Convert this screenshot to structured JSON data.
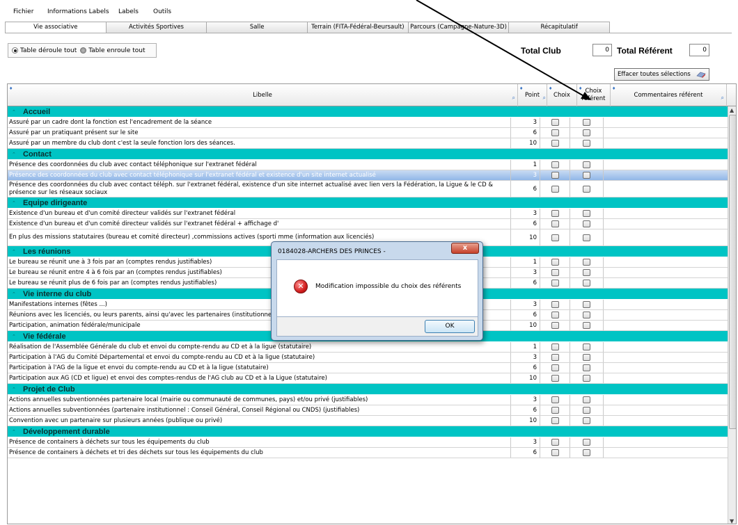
{
  "menu": [
    "Fichier",
    "Informations Labels",
    "Labels",
    "Outils"
  ],
  "tabs": [
    {
      "label": "Vie associative",
      "active": true
    },
    {
      "label": "Activités Sportives"
    },
    {
      "label": "Salle"
    },
    {
      "label": "Terrain (FITA-Fédéral-Beursault)"
    },
    {
      "label": "Parcours (Campagne-Nature-3D)"
    },
    {
      "label": "Récapitulatif"
    }
  ],
  "view": {
    "radio_expand": "Table déroule tout",
    "radio_collapse": "Table enroule tout",
    "selected": "expand"
  },
  "totals": {
    "club_label": "Total Club",
    "club_value": "0",
    "ref_label": "Total Référent",
    "ref_value": "0"
  },
  "clear_button": "Effacer toutes sélections",
  "columns": {
    "libelle": "Libelle",
    "point": "Point",
    "choix": "Choix",
    "choix_ref": "Choix référent",
    "comments": "Commentaires référent"
  },
  "sections": [
    {
      "title": "Accueil",
      "rows": [
        {
          "text": "Assuré par un cadre dont la fonction est l'encadrement de la séance",
          "pt": "3"
        },
        {
          "text": "Assuré par un pratiquant présent sur le site",
          "pt": "6"
        },
        {
          "text": "Assuré par un membre du club dont c'est la seule fonction lors des séances.",
          "pt": "10"
        }
      ]
    },
    {
      "title": "Contact",
      "rows": [
        {
          "text": "Présence des coordonnées du club avec contact téléphonique sur l'extranet fédéral",
          "pt": "1"
        },
        {
          "text": "Présence des coordonnées du club avec contact téléphonique sur l'extranet fédéral et existence d'un site internet actualisé",
          "pt": "3",
          "selected": true
        },
        {
          "text": "Présence des coordonnées du club avec contact téléph. sur l'extranet fédéral, existence d'un site internet actualisé avec lien vers la Fédération, la Ligue & le CD & présence sur les réseaux sociaux",
          "pt": "6",
          "tall": true
        }
      ]
    },
    {
      "title": "Equipe dirigeante",
      "rows": [
        {
          "text": "Existence d'un bureau et d'un comité directeur validés sur l'extranet fédéral",
          "pt": "3"
        },
        {
          "text": "Existence d'un bureau et d'un comité directeur validés sur l'extranet fédéral + affichage d'",
          "pt": "6"
        },
        {
          "text": "En plus des missions statutaires (bureau et comité directeur) ,commissions actives (sporti                                                                                                              mme (information aux licenciés)",
          "pt": "10",
          "tall": true
        }
      ]
    },
    {
      "title": "Les réunions",
      "rows": [
        {
          "text": "Le bureau se réunit une à 3 fois par an (comptes rendus justifiables)",
          "pt": "1"
        },
        {
          "text": "Le bureau se réunit entre 4 à 6 fois par an (comptes rendus justifiables)",
          "pt": "3"
        },
        {
          "text": "Le bureau se réunit plus de 6 fois par an (comptes rendus justifiables)",
          "pt": "6"
        }
      ]
    },
    {
      "title": "Vie interne du club",
      "rows": [
        {
          "text": "Manifestations internes (fêtes ...)",
          "pt": "3"
        },
        {
          "text": "Réunions avec les licenciés, ou leurs parents, ainsi qu'avec les partenaires (institutionnels ou privés)  (pouvoir justifier de lettres, invitations, convocations ...)",
          "pt": "6"
        },
        {
          "text": "Participation, animation fédérale/municipale",
          "pt": "10"
        }
      ]
    },
    {
      "title": "Vie fédérale",
      "rows": [
        {
          "text": "Réalisation de l'Assemblée Générale du club et envoi du compte-rendu au CD et à la ligue (statutaire)",
          "pt": "1"
        },
        {
          "text": "Participation à l'AG du Comité Départemental et envoi du compte-rendu au CD et à la ligue (statutaire)",
          "pt": "3"
        },
        {
          "text": "Participation à l'AG de la ligue et envoi du compte-rendu au CD et à la ligue (statutaire)",
          "pt": "6"
        },
        {
          "text": "Participation aux AG (CD et ligue) et envoi des comptes-rendus de l'AG club au CD et à la Ligue (statutaire)",
          "pt": "10"
        }
      ]
    },
    {
      "title": "Projet de Club",
      "rows": [
        {
          "text": "Actions annuelles subventionnées partenaire local (mairie ou communauté de communes, pays) et/ou privé (justifiables)",
          "pt": "3"
        },
        {
          "text": "Actions annuelles subventionnées (partenaire institutionnel : Conseil Général, Conseil Régional ou CNDS) (justifiables)",
          "pt": "6"
        },
        {
          "text": "Convention avec un partenaire sur plusieurs années (publique ou privé)",
          "pt": "10"
        }
      ]
    },
    {
      "title": "Développement durable",
      "rows": [
        {
          "text": "Présence de containers à déchets sur tous les équipements du club",
          "pt": "3"
        },
        {
          "text": "Présence de containers à déchets et tri des déchets sur tous les équipements du club",
          "pt": "6"
        }
      ]
    }
  ],
  "dialog": {
    "title": "0184028-ARCHERS DES PRINCES -",
    "message": "Modification impossible du choix des référents",
    "ok": "OK",
    "close": "x"
  },
  "colors": {
    "section": "#00c4c4",
    "selection": "#91b7e8"
  }
}
